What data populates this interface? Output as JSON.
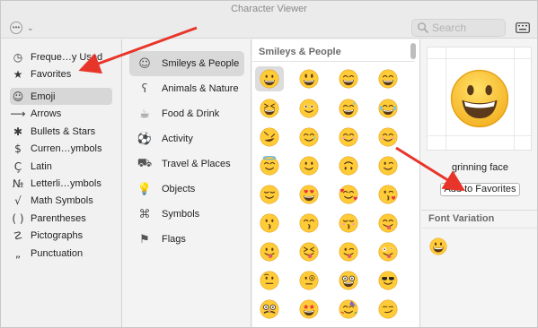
{
  "window": {
    "title": "Character Viewer"
  },
  "toolbar": {
    "action_icon": "ellipsis-circle-icon",
    "action_glyph": "•••",
    "action_chevron": "⌄",
    "search_placeholder": "Search",
    "keyboard_icon": "keyboard-viewer-icon"
  },
  "sidebar": {
    "items": [
      {
        "label": "Freque…y Used",
        "icon": "clock-icon",
        "glyph": "◷"
      },
      {
        "label": "Favorites",
        "icon": "star-icon",
        "glyph": "★"
      },
      {
        "label": "Emoji",
        "icon": "emoji-face-icon",
        "glyph": "☺"
      },
      {
        "label": "Arrows",
        "icon": "arrow-right-icon",
        "glyph": "⟶"
      },
      {
        "label": "Bullets & Stars",
        "icon": "bullets-icon",
        "glyph": "✱"
      },
      {
        "label": "Curren…ymbols",
        "icon": "dollar-icon",
        "glyph": "$"
      },
      {
        "label": "Latin",
        "icon": "latin-c-icon",
        "glyph": "Ç"
      },
      {
        "label": "Letterli…ymbols",
        "icon": "numero-icon",
        "glyph": "№"
      },
      {
        "label": "Math Symbols",
        "icon": "square-root-icon",
        "glyph": "√"
      },
      {
        "label": "Parentheses",
        "icon": "parentheses-icon",
        "glyph": "( )"
      },
      {
        "label": "Pictographs",
        "icon": "pictograph-icon",
        "glyph": "☡"
      },
      {
        "label": "Punctuation",
        "icon": "punctuation-icon",
        "glyph": "„"
      }
    ],
    "selected": "Emoji"
  },
  "categories": {
    "items": [
      {
        "label": "Smileys & People",
        "icon": "smiley-icon",
        "glyph": "☺"
      },
      {
        "label": "Animals & Nature",
        "icon": "bear-icon",
        "glyph": "ʕ"
      },
      {
        "label": "Food & Drink",
        "icon": "cup-icon",
        "glyph": "☕"
      },
      {
        "label": "Activity",
        "icon": "soccer-ball-icon",
        "glyph": "⚽"
      },
      {
        "label": "Travel & Places",
        "icon": "car-icon",
        "glyph": "⛟"
      },
      {
        "label": "Objects",
        "icon": "lightbulb-icon",
        "glyph": "💡"
      },
      {
        "label": "Symbols",
        "icon": "symbols-icon",
        "glyph": "⌘"
      },
      {
        "label": "Flags",
        "icon": "flag-icon",
        "glyph": "⚑"
      }
    ],
    "selected": "Smileys & People"
  },
  "grid": {
    "heading": "Smileys & People",
    "emojis": [
      [
        "grinning-face",
        "grinning-face-big-eyes",
        "grinning-face-smiling-eyes",
        "beaming-face"
      ],
      [
        "grinning-squinting-face",
        "face-holding-back-tears",
        "grinning-face-sweat",
        "face-tears-of-joy"
      ],
      [
        "rolling-on-floor-laughing",
        "face-smiling-tear",
        "smiling-face",
        "smiling-face-smiling-eyes"
      ],
      [
        "smiling-face-with-halo",
        "slightly-smiling-face",
        "upside-down-face",
        "winking-face"
      ],
      [
        "relieved-face",
        "heart-eyes-face",
        "smiling-face-with-hearts",
        "face-blowing-kiss"
      ],
      [
        "kissing-face",
        "kissing-face-smiling-eyes",
        "kissing-face-closed-eyes",
        "face-savoring-food"
      ],
      [
        "face-with-tongue",
        "squinting-face-tongue",
        "winking-face-tongue",
        "zany-face"
      ],
      [
        "face-raised-eyebrow",
        "face-with-monocle",
        "nerd-face",
        "smiling-face-sunglasses"
      ],
      [
        "disguised-face",
        "star-struck",
        "partying-face",
        "smirking-face"
      ]
    ],
    "selected": "grinning-face"
  },
  "detail": {
    "character_name": "grinning face",
    "add_to_favorites": "Add to Favorites",
    "font_variation_heading": "Font Variation"
  },
  "colors": {
    "emoji_yellow": "#ffcc38",
    "emoji_outline": "#e39f14",
    "emoji_feature": "#5a3a1a",
    "annotation_arrow": "#e8352a"
  }
}
